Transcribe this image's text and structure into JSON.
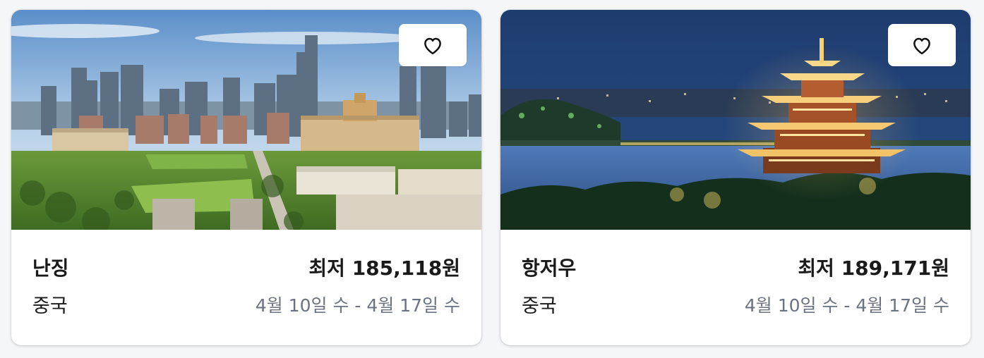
{
  "cards": [
    {
      "image_alt": "Nanjing city skyline with skyscrapers and green park",
      "favorite_icon": "heart-outline-icon",
      "city": "난징",
      "price_prefix": "최저",
      "price_amount": "185,118원",
      "country": "중국",
      "dates": "4월 10일 수 - 4월 17일 수"
    },
    {
      "image_alt": "Hangzhou night view with illuminated pagoda over lake",
      "favorite_icon": "heart-outline-icon",
      "city": "항저우",
      "price_prefix": "최저",
      "price_amount": "189,171원",
      "country": "중국",
      "dates": "4월 10일 수 - 4월 17일 수"
    }
  ]
}
